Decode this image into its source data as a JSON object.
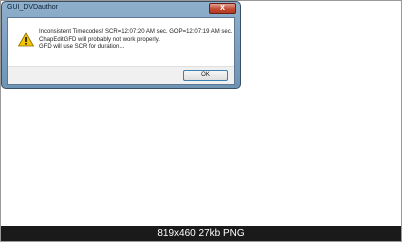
{
  "dialog": {
    "title": "GUI_DVDauthor",
    "close_glyph": "x",
    "icon": "warning-icon",
    "message_lines": [
      "Inconsistent Timecodes!  SCR=12:07:20 AM sec.  GOP=12:07:19 AM sec.",
      "ChapEditGFD will probably not work properly.",
      "GFD will use SCR for duration..."
    ],
    "ok_label": "OK"
  },
  "caption": "819x460 27kb PNG"
}
